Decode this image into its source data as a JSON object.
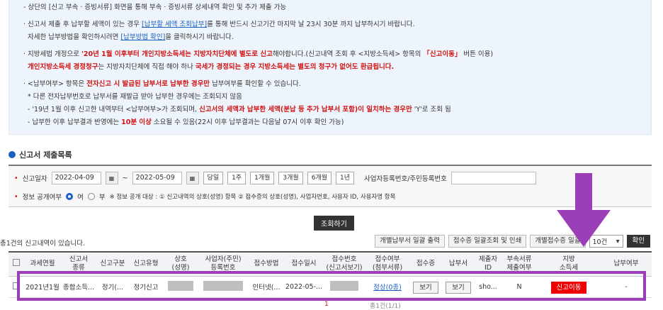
{
  "notice": {
    "l1": "- 상단의 [신고 부속 · 증빙서류] 화면을 통해 부속 · 증빙서류 상세내역 확인 및 추가 제출 가능",
    "l2a": "· 신고서 제출 후 납부할 세액이 있는 경우 ",
    "l2link": "[납부할 세액 조회납부]",
    "l2b": "를 통해 반드시 신고기간 마지막 날 23시 30분 까지 납부하시기 바랍니다.",
    "l3a": "자세한 납부방법을 확인하시려면 ",
    "l3link": "[납부방법 확인]",
    "l3b": "을 클릭하시기 바랍니다.",
    "l4a": "· 지방세법 개정으로 ",
    "l4red": "'20년 1월 이후부터 개인지방소득세는 지방자치단체에 별도로 신고",
    "l4b": "해야합니다.(신고내역 조회 후 <지방소득세> 항목의 ",
    "l4red2": "「신고이동」",
    "l4c": " 버튼 이용)",
    "l5red": "개인지방소득세 경정청구",
    "l5a": "는 지방자치단체에 직접 해야 하나 ",
    "l5red2": "국세가 경정되는 경우 지방소득세는 별도의 청구가 없어도 환급됩니다.",
    "l6a": "· <납부여부> 항목은 ",
    "l6red": "전자신고 시 발급된 납부서로 납부한 경우만",
    "l6b": " 납부여부를 확인할 수 있습니다.",
    "l7": "* 다른 전자납부번호로 납부서를 재발급 받아 납부한 경우에는 조회되지 않음",
    "l8a": "- '19년 1월 이후 신고한 내역부터 <납부여부>가 조회되며, ",
    "l8red": "신고서의 세액과 납부한 세액(분납 등 추가 납부서 포함)이 일치하는 경우만",
    "l8b": " 'Y'로 조회 됨",
    "l9a": "- 납부한 이후 납부결과 반영에는 ",
    "l9red": "10분 이상",
    "l9b": " 소요될 수 있음(22시 이후 납부결과는 다음날 07시 이후 확인 가능)"
  },
  "section_title": "신고서 제출목록",
  "search": {
    "date_label": "신고일자",
    "date_from": "2022-04-09",
    "tilde": "~",
    "date_to": "2022-05-09",
    "quick": [
      "당일",
      "1주",
      "1개월",
      "3개월",
      "6개월",
      "1년"
    ],
    "bizno_label": "사업자등록번호/주민등록번호",
    "disclose_label": "정보 공개여부",
    "yes": "여",
    "no": "부",
    "disclose_note": "※ 정보 공개 대상 : ① 신고내역의 상호(성명) 항목 ② 접수증의 상호(성명), 사업자번호, 사용자 ID, 사용자명 항목",
    "search_btn": "조회하기"
  },
  "count_text": "총1건의 신고내역이 있습니다.",
  "tools": {
    "b1": "개별납부서 일괄 출력",
    "b2": "접수증 일괄조회 및 인쇄",
    "b3": "개별접수증 일괄",
    "page_size": "10건",
    "confirm": "확인"
  },
  "headers": [
    "과세연월",
    "신고서\n종류",
    "신고구분",
    "신고유형",
    "상호\n(성명)",
    "사업자(주민)\n등록번호",
    "접수방법",
    "접수일시",
    "접수번호\n(신고서보기)",
    "접수여부\n(첨부서류)",
    "접수증",
    "납부서",
    "제출자\nID",
    "부속서류\n제출여부",
    "지방\n소득세",
    "납부여부"
  ],
  "row": {
    "period": "2021년1월",
    "type": "종합소득...",
    "div": "정기(...",
    "kind": "정기신고",
    "method": "인터넷(...",
    "date": "2022-05-...",
    "status": "정상(0종)",
    "receipt": "보기",
    "bill": "보기",
    "submitter": "sho...",
    "attach": "N",
    "local_tax": "신고이동",
    "paid": "-"
  },
  "pager": {
    "page": "1",
    "total": "총1건(1/1)"
  },
  "colors": {
    "highlight": "#9b3fb8",
    "accent": "#1c5fc4",
    "danger": "#e00000"
  }
}
